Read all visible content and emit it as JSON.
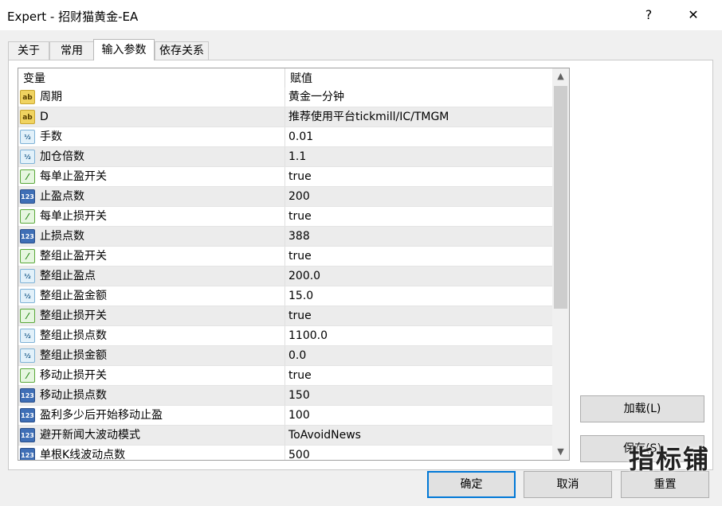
{
  "window": {
    "title": "Expert - 招财猫黄金-EA",
    "help_glyph": "?",
    "close_glyph": "✕"
  },
  "tabs": [
    {
      "label": "关于"
    },
    {
      "label": "常用"
    },
    {
      "label": "输入参数"
    },
    {
      "label": "依存关系"
    }
  ],
  "active_tab": "输入参数",
  "grid": {
    "columns": {
      "variable": "变量",
      "value": "赋值"
    },
    "rows": [
      {
        "name": "周期",
        "value": "黄金一分钟",
        "type": "string-icon",
        "icon_text": "ab"
      },
      {
        "name": "D",
        "value": "推荐使用平台tickmill/IC/TMGM",
        "type": "string-icon",
        "icon_text": "ab"
      },
      {
        "name": "手数",
        "value": "0.01",
        "type": "double-icon",
        "icon_text": "½"
      },
      {
        "name": "加仓倍数",
        "value": "1.1",
        "type": "double-icon",
        "icon_text": "½"
      },
      {
        "name": "每单止盈开关",
        "value": "true",
        "type": "bool-icon",
        "icon_text": "⁄"
      },
      {
        "name": "止盈点数",
        "value": "200",
        "type": "int-icon",
        "icon_text": "123"
      },
      {
        "name": "每单止损开关",
        "value": "true",
        "type": "bool-icon",
        "icon_text": "⁄"
      },
      {
        "name": "止损点数",
        "value": "388",
        "type": "int-icon",
        "icon_text": "123"
      },
      {
        "name": "整组止盈开关",
        "value": "true",
        "type": "bool-icon",
        "icon_text": "⁄"
      },
      {
        "name": "整组止盈点",
        "value": "200.0",
        "type": "double-icon",
        "icon_text": "½"
      },
      {
        "name": "整组止盈金额",
        "value": "15.0",
        "type": "double-icon",
        "icon_text": "½"
      },
      {
        "name": "整组止损开关",
        "value": "true",
        "type": "bool-icon",
        "icon_text": "⁄"
      },
      {
        "name": "整组止损点数",
        "value": "1100.0",
        "type": "double-icon",
        "icon_text": "½"
      },
      {
        "name": "整组止损金额",
        "value": "0.0",
        "type": "double-icon",
        "icon_text": "½"
      },
      {
        "name": "移动止损开关",
        "value": "true",
        "type": "bool-icon",
        "icon_text": "⁄"
      },
      {
        "name": "移动止损点数",
        "value": "150",
        "type": "int-icon",
        "icon_text": "123"
      },
      {
        "name": "盈利多少后开始移动止盈",
        "value": "100",
        "type": "int-icon",
        "icon_text": "123"
      },
      {
        "name": "避开新闻大波动模式",
        "value": "ToAvoidNews",
        "type": "int-icon",
        "icon_text": "123"
      },
      {
        "name": "单根K线波动点数",
        "value": "500",
        "type": "int-icon",
        "icon_text": "123"
      }
    ]
  },
  "scrollbar": {
    "up_glyph": "▲",
    "down_glyph": "▼"
  },
  "buttons": {
    "load": "加载(L)",
    "save": "保存(S)",
    "ok": "确定",
    "cancel": "取消",
    "reset": "重置"
  },
  "watermark": "指标铺"
}
